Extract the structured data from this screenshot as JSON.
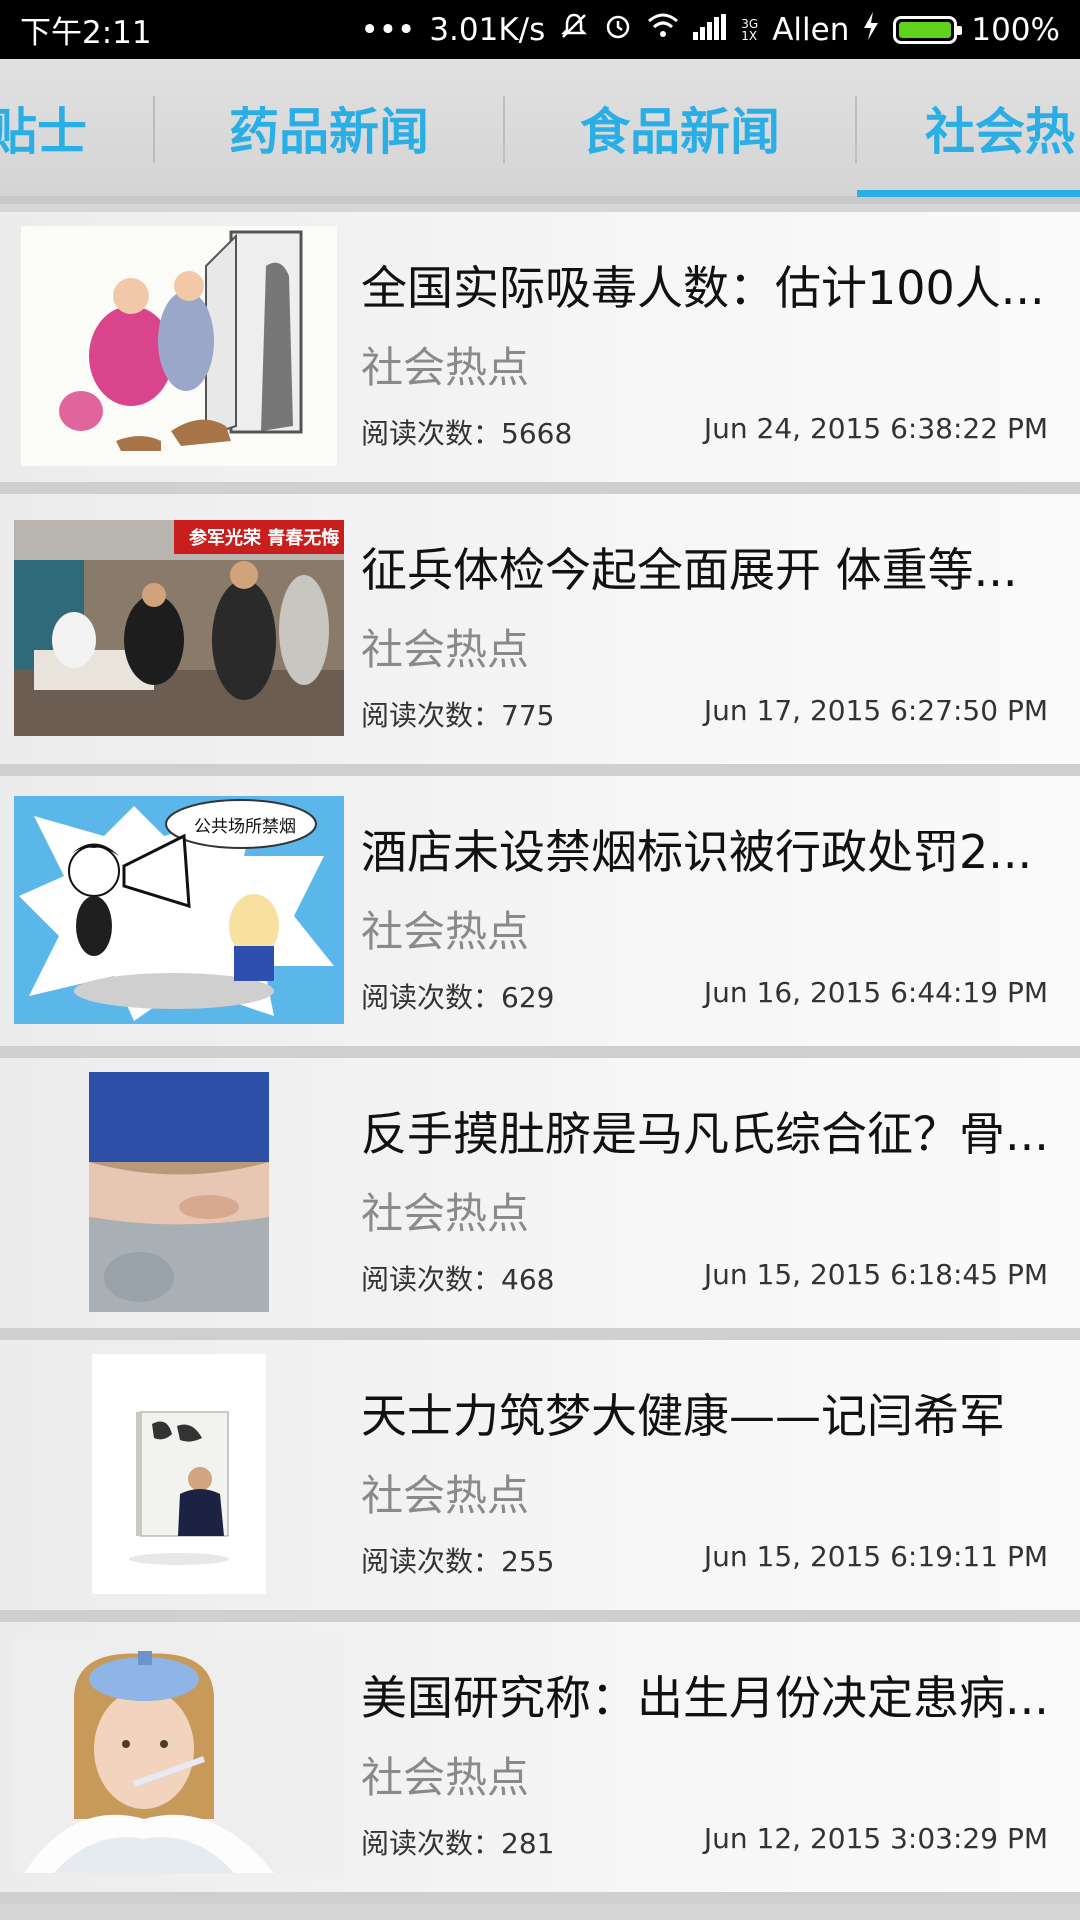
{
  "status_bar": {
    "time": "下午2:11",
    "dots": "•••",
    "speed": "3.01K/s",
    "network_small": "3G\n1X",
    "carrier": "Allen",
    "battery": "100%"
  },
  "tabs": [
    {
      "label": "贴士"
    },
    {
      "label": "药品新闻"
    },
    {
      "label": "食品新闻"
    },
    {
      "label": "社会热"
    }
  ],
  "colors": {
    "accent": "#29aee6",
    "battery_green": "#5fd31c"
  },
  "news": [
    {
      "title": "全国实际吸毒人数：估计100人...",
      "category": "社会热点",
      "reads": "阅读次数：5668",
      "date": "Jun 24, 2015 6:38:22 PM",
      "thumb_icon": "cartoon-door-family-image"
    },
    {
      "title": "征兵体检今起全面展开 体重等...",
      "category": "社会热点",
      "reads": "阅读次数：775",
      "date": "Jun 17, 2015 6:27:50 PM",
      "thumb_icon": "military-physical-exam-photo",
      "thumb_text": "参军光荣 青春无悔"
    },
    {
      "title": "酒店未设禁烟标识被行政处罚2...",
      "category": "社会热点",
      "reads": "阅读次数：629",
      "date": "Jun 16, 2015 6:44:19 PM",
      "thumb_icon": "no-smoking-cartoon-image",
      "thumb_text": "公共场所禁烟"
    },
    {
      "title": "反手摸肚脐是马凡氏综合征？骨...",
      "category": "社会热点",
      "reads": "阅读次数：468",
      "date": "Jun 15, 2015 6:18:45 PM",
      "thumb_icon": "belly-button-photo"
    },
    {
      "title": "天士力筑梦大健康——记闫希军",
      "category": "社会热点",
      "reads": "阅读次数：255",
      "date": "Jun 15, 2015 6:19:11 PM",
      "thumb_icon": "book-cover-image"
    },
    {
      "title": "美国研究称：出生月份决定患病...",
      "category": "社会热点",
      "reads": "阅读次数：281",
      "date": "Jun 12, 2015 3:03:29 PM",
      "thumb_icon": "sick-girl-thermometer-photo"
    }
  ]
}
